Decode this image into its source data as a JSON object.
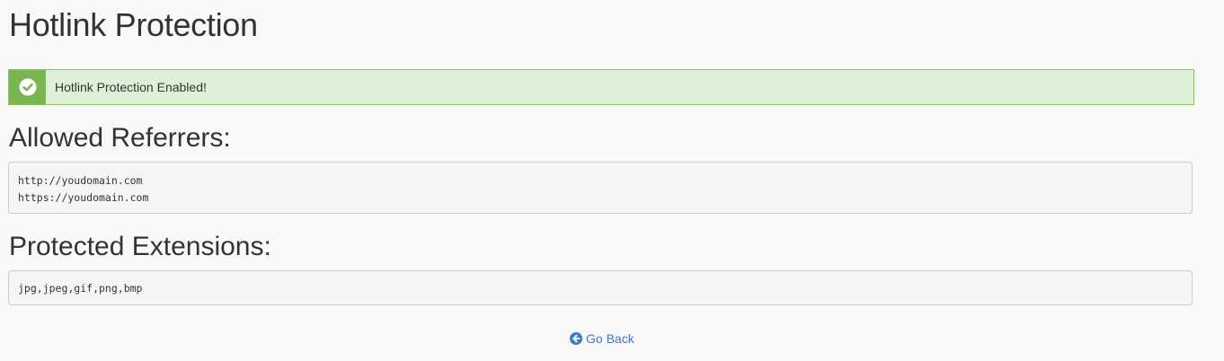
{
  "page": {
    "title": "Hotlink Protection"
  },
  "alert": {
    "icon": "check-circle-icon",
    "message": "Hotlink Protection Enabled!",
    "colors": {
      "background": "#dff0d8",
      "border": "#8cbf5a",
      "icon_box": "#7ab650"
    }
  },
  "allowed_referrers": {
    "heading": "Allowed Referrers:",
    "items": [
      "http://youdomain.com",
      "https://youdomain.com"
    ]
  },
  "protected_extensions": {
    "heading": "Protected Extensions:",
    "value": "jpg,jpeg,gif,png,bmp"
  },
  "footer": {
    "go_back_label": "Go Back",
    "go_back_icon": "arrow-circle-left-icon",
    "link_color": "#3a7cc1"
  }
}
